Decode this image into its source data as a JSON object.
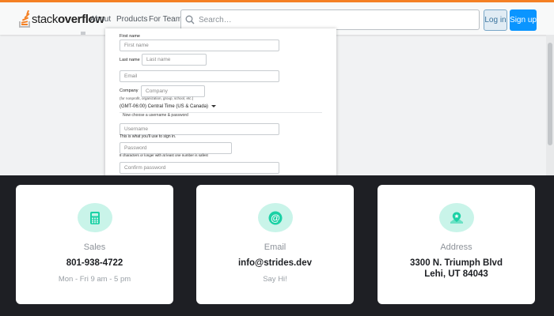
{
  "header": {
    "logo": {
      "light": "stack",
      "bold": "overflow"
    },
    "nav": [
      "About",
      "Products",
      "For Teams"
    ],
    "search_placeholder": "Search…",
    "login_label": "Log in",
    "signup_label": "Sign up"
  },
  "form": {
    "first_name_label": "First name",
    "first_name_placeholder": "First name",
    "last_name_label": "Last name",
    "last_name_placeholder": "Last name",
    "email_placeholder": "Email",
    "company_label": "Company",
    "company_placeholder": "Company",
    "company_hint": "(for nonprofit, organization, group, school, etc.)",
    "timezone_value": "(GMT-06:00) Central Time (US & Canada)",
    "credentials_heading": "Now choose a username & password",
    "username_placeholder": "Username",
    "username_hint": "This is what you'll use to sign in.",
    "password_placeholder": "Password",
    "password_hint": "8 characters or longer with at least one number is safest",
    "confirm_placeholder": "Confirm password"
  },
  "contact": {
    "accent_color": "#c9f4e9",
    "cards": [
      {
        "icon": "calculator-icon",
        "title": "Sales",
        "value": "801-938-4722",
        "sub": "Mon - Fri 9 am - 5 pm"
      },
      {
        "icon": "at-sign-icon",
        "title": "Email",
        "value": "info@strides.dev",
        "sub": "Say Hi!"
      },
      {
        "icon": "map-pin-icon",
        "title": "Address",
        "value_lines": [
          "3300 N. Triumph Blvd",
          "Lehi, UT 84043"
        ]
      }
    ]
  }
}
